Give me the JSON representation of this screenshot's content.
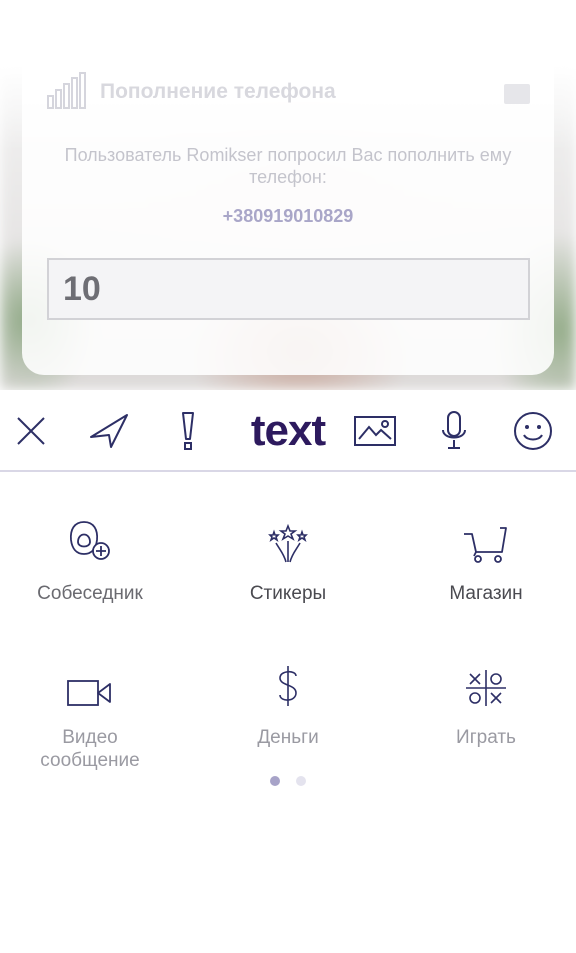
{
  "request_card": {
    "title": "Пополнение телефона",
    "message": "Пользователь Romikser попросил Вас пополнить ему телефон:",
    "phone": "+380919010829",
    "amount_value": "10"
  },
  "toolbar": {
    "close_icon": "close-icon",
    "send_icon": "send-arrow-icon",
    "urgent_icon": "exclamation-icon",
    "text_label": "text",
    "image_icon": "image-icon",
    "mic_icon": "microphone-icon",
    "emoji_icon": "smiley-icon"
  },
  "attach_menu": {
    "items": [
      {
        "label": "Собеседник",
        "icon": "contact-add-icon"
      },
      {
        "label": "Стикеры",
        "icon": "stickers-icon"
      },
      {
        "label": "Магазин",
        "icon": "shopping-cart-icon"
      },
      {
        "label": "Видео\nсообщение",
        "icon": "video-camera-icon"
      },
      {
        "label": "Деньги",
        "icon": "dollar-icon"
      },
      {
        "label": "Играть",
        "icon": "tic-tac-toe-icon"
      }
    ],
    "page_current": 1,
    "page_count": 2
  },
  "colors": {
    "accent": "#2d1a5e",
    "icon_stroke": "#2d2f66",
    "pager_active": "#a7a3c8",
    "pager_inactive": "#e4e3ee"
  }
}
